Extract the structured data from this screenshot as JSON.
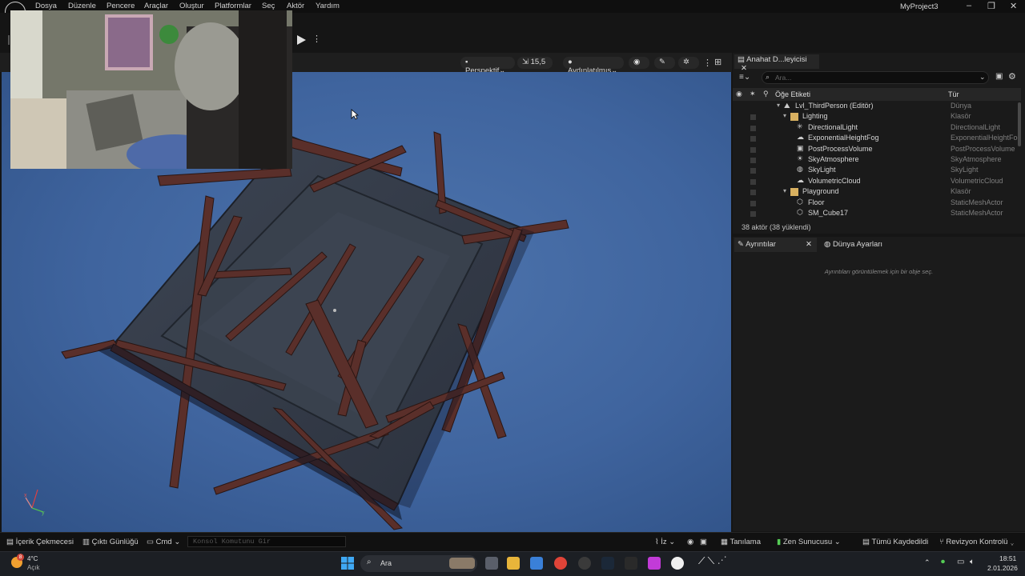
{
  "menu": [
    "Dosya",
    "Düzenle",
    "Pencere",
    "Araçlar",
    "Oluştur",
    "Platformlar",
    "Seç",
    "Aktör",
    "Yardım"
  ],
  "window": {
    "title": "MyProject3",
    "minimize": "–",
    "restore": "❐",
    "close": "✕"
  },
  "viewport": {
    "perspective": "Perspektif",
    "fov": "15,5",
    "lit": "Aydınlatılmış",
    "axis_x": "x",
    "axis_y": "y"
  },
  "outliner": {
    "tab_label": "Anahat D...leyicisi",
    "search_placeholder": "Ara...",
    "col_label": "Öğe Etiketi",
    "col_type": "Tür",
    "rows": [
      {
        "label": "Lvl_ThirdPerson (Editör)",
        "type": "Dünya"
      },
      {
        "label": "Lighting",
        "type": "Klasör"
      },
      {
        "label": "DirectionalLight",
        "type": "DirectionalLight"
      },
      {
        "label": "ExponentialHeightFog",
        "type": "ExponentialHeightFog"
      },
      {
        "label": "PostProcessVolume",
        "type": "PostProcessVolume"
      },
      {
        "label": "SkyAtmosphere",
        "type": "SkyAtmosphere"
      },
      {
        "label": "SkyLight",
        "type": "SkyLight"
      },
      {
        "label": "VolumetricCloud",
        "type": "VolumetricCloud"
      },
      {
        "label": "Playground",
        "type": "Klasör"
      },
      {
        "label": "Floor",
        "type": "StaticMeshActor"
      },
      {
        "label": "SM_Cube17",
        "type": "StaticMeshActor"
      }
    ],
    "footer": "38 aktör (38 yüklendi)"
  },
  "details": {
    "tab_details": "Ayrıntılar",
    "tab_world": "Dünya Ayarları",
    "empty_message": "Ayrıntıları görüntülemek için bir obje seç."
  },
  "statusbar": {
    "content_drawer": "İçerik Çekmecesi",
    "output_log": "Çıktı Günlüğü",
    "cmd": "Cmd",
    "cmd_placeholder": "Konsol Komutunu Gir",
    "trace": "İz",
    "diagnostics": "Tanılama",
    "zen": "Zen Sunucusu",
    "saved": "Tümü Kaydedildi",
    "revision": "Revizyon Kontrolü"
  },
  "taskbar": {
    "weather_temp": "4°C",
    "weather_desc": "Açık",
    "weather_badge": "8",
    "search": "Ara",
    "time": "18:51",
    "date": "2.01.2026"
  },
  "colors": {
    "sky": "#4d74ad",
    "accent": "#1e7fe0",
    "folder": "#d8b060"
  }
}
